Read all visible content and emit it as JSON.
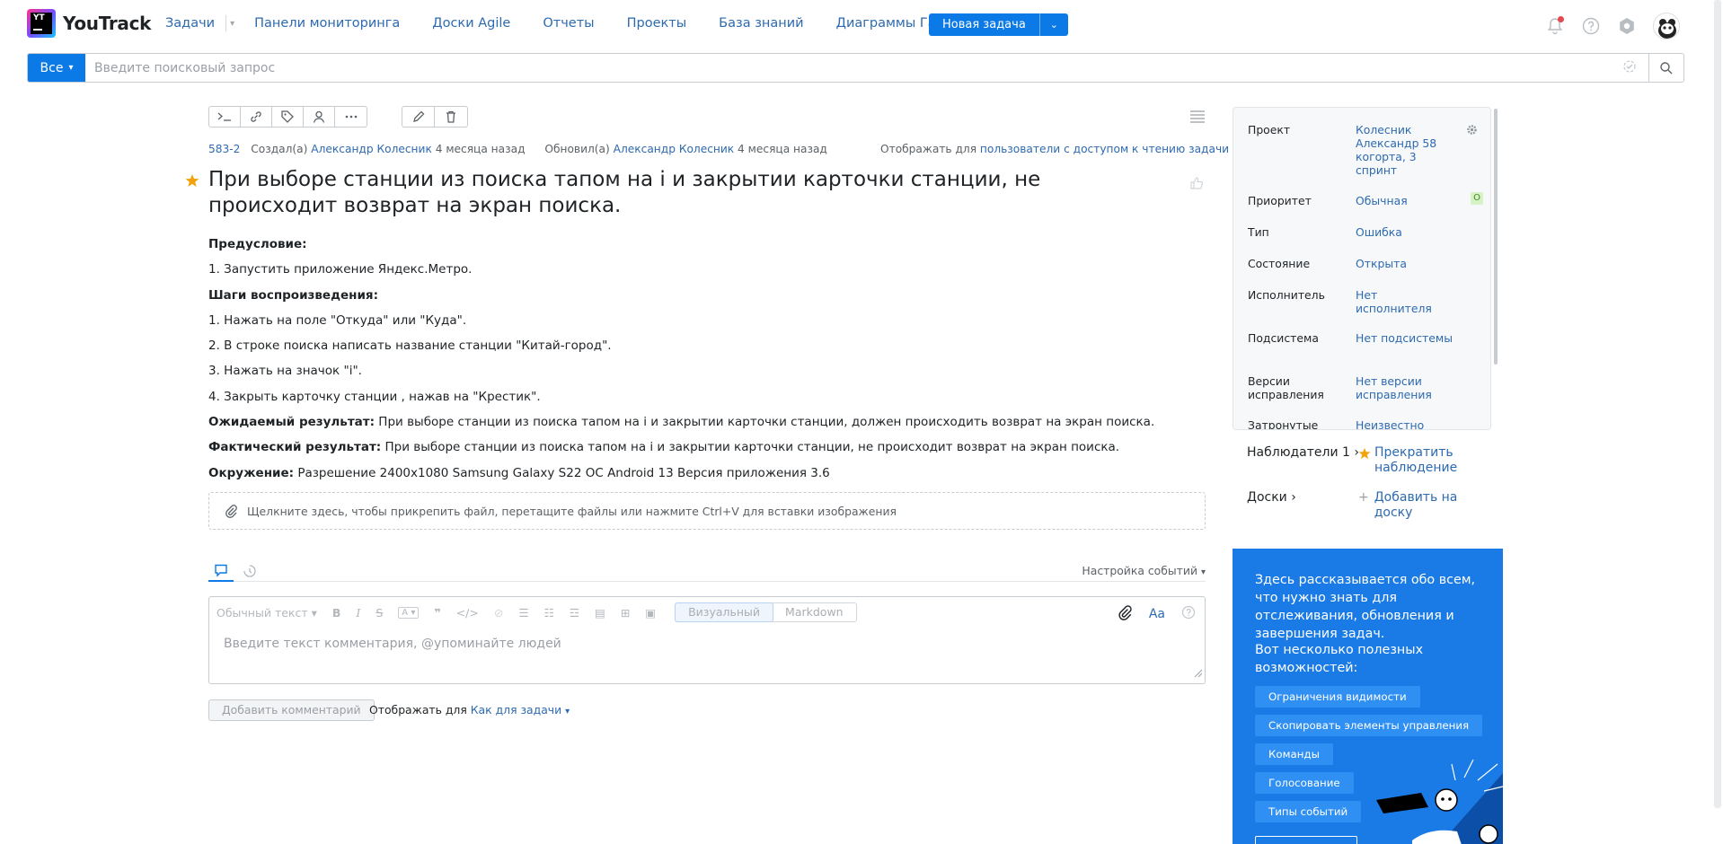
{
  "app": {
    "brand": "YouTrack",
    "logo_letters": "YT"
  },
  "nav": {
    "items": [
      "Задачи",
      "Панели мониторинга",
      "Доски Agile",
      "Отчеты",
      "Проекты",
      "База знаний",
      "Диаграммы Ганта"
    ],
    "new_task": "Новая задача"
  },
  "search": {
    "context": "Все",
    "placeholder": "Введите поисковый запрос"
  },
  "issue": {
    "id": "583-2",
    "created_label": "Создал(а)",
    "created_by": "Александр Колесник",
    "created_when": "4 месяца назад",
    "updated_label": "Обновил(а)",
    "updated_by": "Александр Колесник",
    "updated_when": "4 месяца назад",
    "visibility_label": "Отображать для",
    "visibility_value": "пользователи с доступом к чтению задачи",
    "title": "При выборе станции из поиска тапом на i и закрытии карточки станции, не происходит возврат на экран поиска.",
    "description": {
      "precondition_label": "Предусловие:",
      "precondition_1": "1. Запустить приложение Яндекс.Метро.",
      "steps_label": "Шаги воспроизведения:",
      "step_1": "1. Нажать на поле \"Откуда\" или \"Куда\".",
      "step_2": "2. В строке поиска написать название станции \"Китай-город\".",
      "step_3": "3. Нажать на значок \"i\".",
      "step_4": "4. Закрыть карточку станции , нажав на \"Крестик\".",
      "expected_label": "Ожидаемый результат:",
      "expected_text": " При выборе станции из поиска тапом на i и закрытии карточки станции, должен происходить возврат на экран поиска.",
      "actual_label": "Фактический результат:",
      "actual_text": " При выборе станции из поиска тапом на i и закрытии карточки станции, не происходит возврат на экран поиска.",
      "env_label": "Окружение:",
      "env_text": " Разрешение 2400x1080 Samsung Galaxy S22 ОС Android 13 Версия приложения 3.6"
    },
    "attach_hint": "Щелкните здесь, чтобы прикрепить файл, перетащите файлы или нажмите Ctrl+V для вставки изображения"
  },
  "activity": {
    "events_settings": "Настройка событий",
    "editor": {
      "text_style": "Обычный текст",
      "mode_visual": "Визуальный",
      "mode_markdown": "Markdown",
      "placeholder": "Введите текст комментария, @упоминайте людей",
      "aa": "Aa"
    },
    "add_comment": "Добавить комментарий",
    "comment_visibility_label": "Отображать для",
    "comment_visibility_value": "Как для задачи"
  },
  "fields": [
    {
      "label": "Проект",
      "value": "Колесник Александр 58 когорта, 3 спринт"
    },
    {
      "label": "Приоритет",
      "value": "Обычная",
      "badge": "О"
    },
    {
      "label": "Тип",
      "value": "Ошибка"
    },
    {
      "label": "Состояние",
      "value": "Открыта"
    },
    {
      "label": "Исполнитель",
      "value": "Нет исполнителя"
    },
    {
      "label": "Подсистема",
      "value": "Нет подсистемы"
    },
    {
      "label": "Версии исправления",
      "value": "Нет версии исправления"
    },
    {
      "label": "Затронутые",
      "value": "Неизвестно"
    }
  ],
  "watchers": {
    "label": "Наблюдатели",
    "count": "1",
    "action": "Прекратить наблюдение"
  },
  "boards": {
    "label": "Доски",
    "action": "Добавить на доску"
  },
  "promo": {
    "intro": "Здесь рассказывается обо всем, что нужно знать для отслеживания, обновления и завершения задач.",
    "useful": "Вот несколько полезных возможностей:",
    "chips": [
      "Ограничения видимости",
      "Скопировать элементы управления",
      "Команды",
      "Голосование",
      "Типы событий"
    ]
  },
  "colors": {
    "accent": "#0c7ae6",
    "link": "#2d6ab0",
    "promo_bg": "#1a7be6",
    "star": "#f2a20c"
  }
}
